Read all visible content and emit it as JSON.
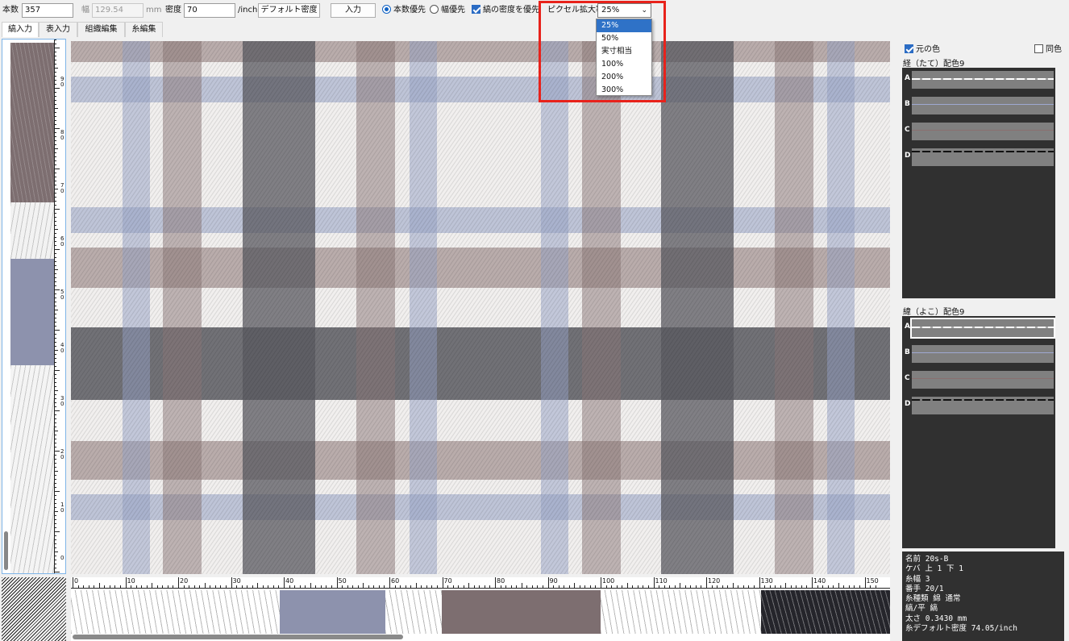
{
  "toolbar": {
    "count_label": "本数",
    "count_value": "357",
    "width_label": "幅",
    "width_value": "129.54",
    "width_unit": "mm",
    "density_label": "密度",
    "density_value": "70",
    "density_unit": "/inch",
    "default_density_button": "デフォルト密度",
    "input_button": "入力",
    "radio_count_priority": "本数優先",
    "radio_width_priority": "幅優先",
    "check_warp_density": "縞の密度を優先",
    "pixel_zoom_label": "ピクセル拡大率",
    "pixel_zoom_value": "25%"
  },
  "zoom_options": [
    "25%",
    "50%",
    "実寸相当",
    "100%",
    "200%",
    "300%"
  ],
  "tabs": [
    "縞入力",
    "表入力",
    "組織編集",
    "糸編集"
  ],
  "ruler_vertical_labels": [
    "9\n0",
    "8\n0",
    "7\n0",
    "6\n0",
    "5\n0",
    "4\n0",
    "3\n0",
    "2\n0",
    "1\n0",
    "0"
  ],
  "ruler_horizontal_labels": [
    "0",
    "10",
    "20",
    "30",
    "40",
    "50",
    "60",
    "70",
    "80",
    "90",
    "100",
    "110",
    "120",
    "130",
    "140",
    "150"
  ],
  "right_panel": {
    "original_color_label": "元の色",
    "same_color_label": "同色",
    "warp_title": "経（たて）配色9",
    "weft_title": "緯（よこ）配色9",
    "swatch_letters": [
      "A",
      "B",
      "C",
      "D"
    ],
    "info": [
      "名前 20s-B",
      "ケバ 上 1 下 1",
      "糸幅 3",
      "番手 20/1",
      "糸種類 綿 通常",
      "縞/平 縞",
      "太さ 0.3430 mm",
      "糸デフォルト密度 74.05/inch"
    ]
  },
  "colors": {
    "pale": "#f1efee",
    "blue": "#94a0c4",
    "mauve": "#8a7575",
    "dark": "#5a5a60",
    "accent": "#2f72c7",
    "highlight": "#e8221b"
  }
}
